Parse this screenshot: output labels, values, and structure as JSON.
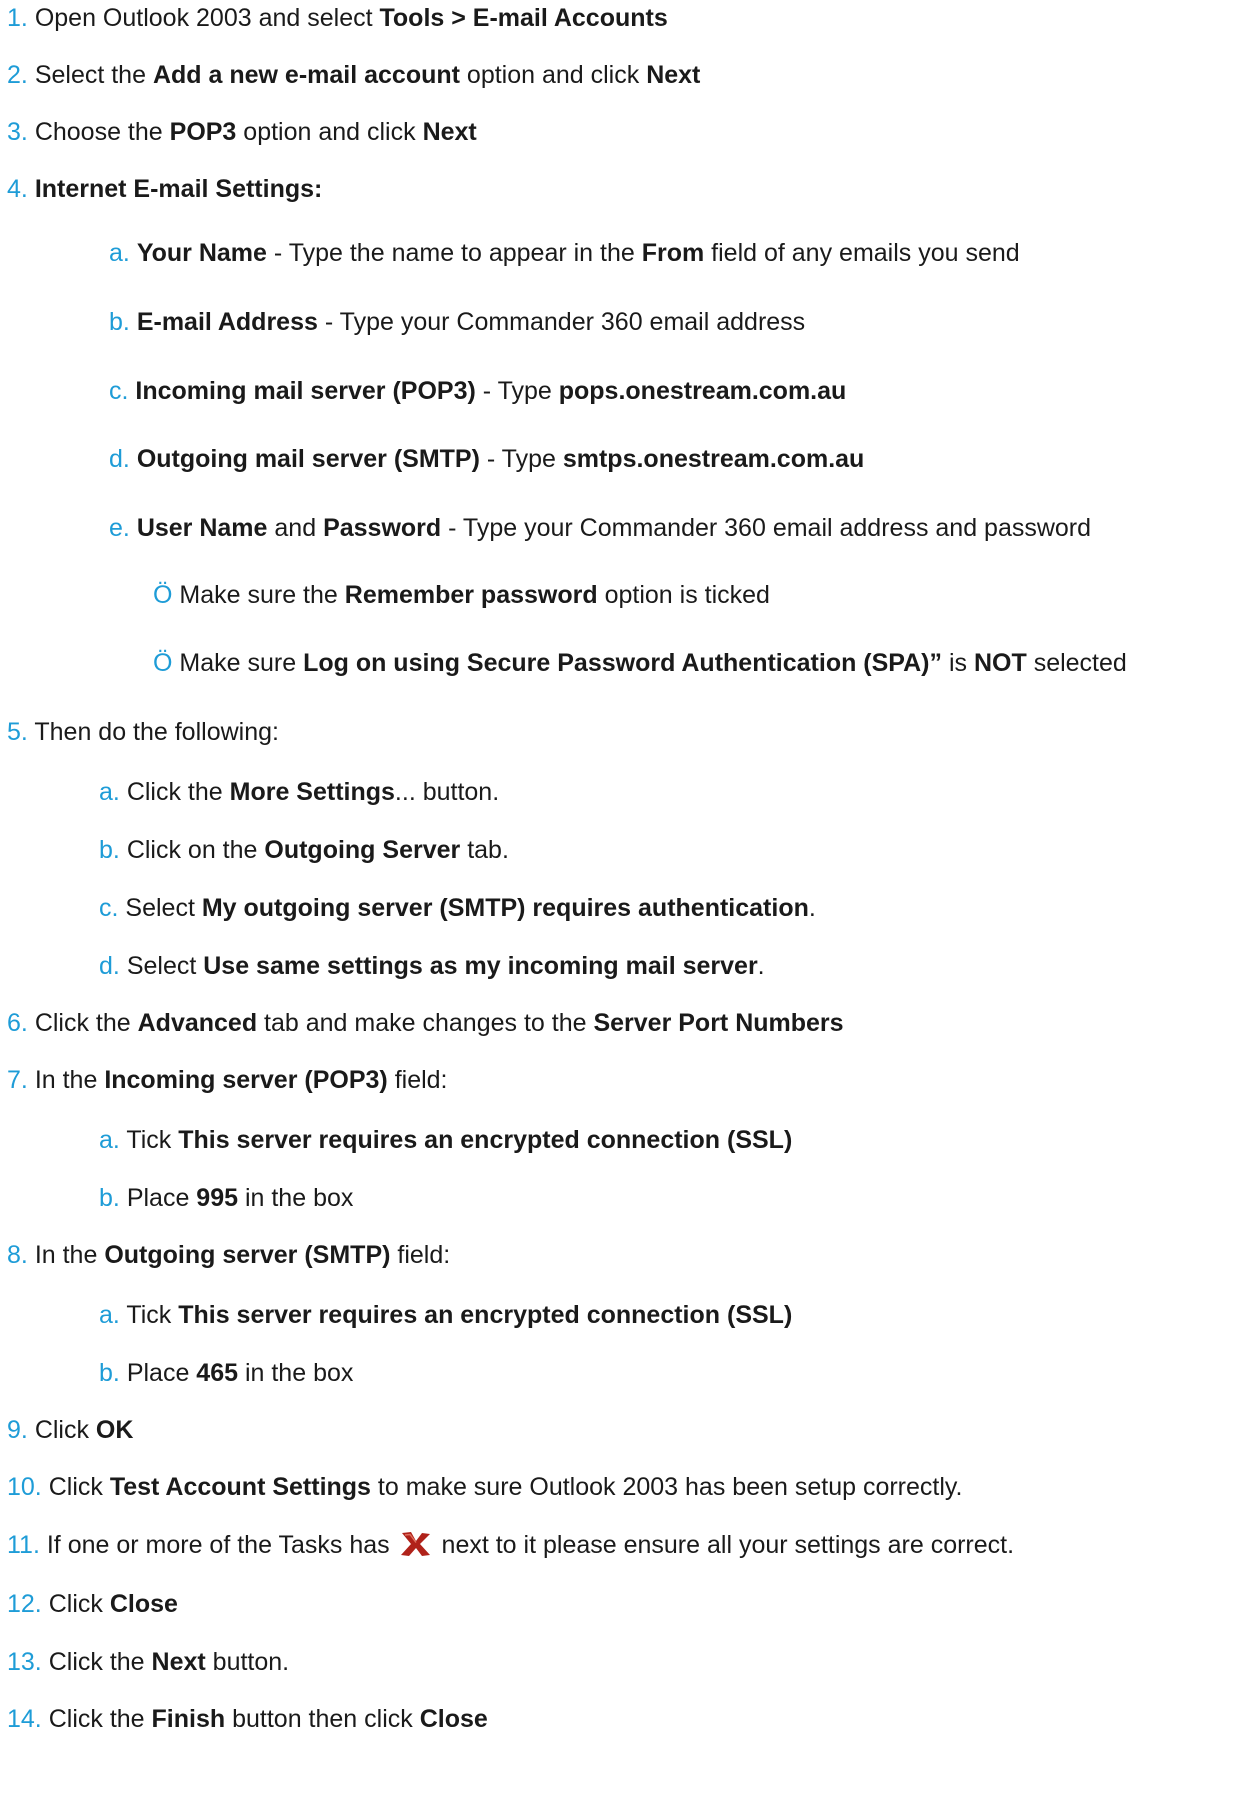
{
  "colors": {
    "number": "#1e9cd7",
    "text": "#1a1a1a",
    "x_icon": "#b0221a"
  },
  "steps": [
    {
      "num": "1.",
      "t1": "Open Outlook 2003 and select ",
      "b1": "Tools > E-mail Accounts"
    },
    {
      "num": "2.",
      "t1": "Select the ",
      "b1": "Add a new e-mail account",
      "t2": " option and click ",
      "b2": "Next"
    },
    {
      "num": "3.",
      "t1": "Choose the ",
      "b1": "POP3",
      "t2": " option and click ",
      "b2": "Next"
    },
    {
      "num": "4.",
      "b1": "Internet E-mail Settings:"
    },
    {
      "num": "5.",
      "t1": "Then do the following:"
    },
    {
      "num": "6.",
      "t1": "Click the ",
      "b1": "Advanced",
      "t2": " tab and make changes to the ",
      "b2": "Server Port Numbers"
    },
    {
      "num": "7.",
      "t1": "In the ",
      "b1": "Incoming server (POP3)",
      "t2": " field:"
    },
    {
      "num": "8.",
      "t1": "In the ",
      "b1": "Outgoing server (SMTP)",
      "t2": " field:"
    },
    {
      "num": "9.",
      "t1": "Click ",
      "b1": "OK"
    },
    {
      "num": "10.",
      "t1": "Click ",
      "b1": "Test Account Settings",
      "t2": " to make sure Outlook 2003 has been setup correctly."
    },
    {
      "num": "11.",
      "t1": "If one or more of the Tasks has ",
      "t2": " next to it please ensure all your settings are correct."
    },
    {
      "num": "12.",
      "t1": "Click ",
      "b1": "Close"
    },
    {
      "num": "13.",
      "t1": "Click the ",
      "b1": "Next",
      "t2": " button."
    },
    {
      "num": "14.",
      "t1": "Click the ",
      "b1": "Finish",
      "t2": " button then click ",
      "b2": "Close"
    }
  ],
  "step4_sub": [
    {
      "letter": "a.",
      "b1": "Your Name",
      "t1": " - Type the name to appear in the ",
      "b2": "From",
      "t2": " field of any emails you send"
    },
    {
      "letter": "b.",
      "b1": "E-mail Address",
      "t1": " - Type your Commander 360 email address"
    },
    {
      "letter": "c.",
      "b1": "Incoming mail server (POP3)",
      "t1": " - Type ",
      "b2": "pops.onestream.com.au"
    },
    {
      "letter": "d.",
      "b1": "Outgoing mail server (SMTP)",
      "t1": " - Type ",
      "b2": "smtps.onestream.com.au"
    },
    {
      "letter": "e.",
      "b1": "User Name",
      "t1": " and ",
      "b2": "Password",
      "t2": " - Type your Commander 360 email address and password"
    }
  ],
  "step4_checks": [
    {
      "mark": "Ö",
      "t1": " Make sure the ",
      "b1": "Remember password",
      "t2": " option is ticked"
    },
    {
      "mark": "Ö",
      "t1": " Make sure ",
      "b1": "Log on using Secure Password Authentication (SPA)”",
      "t2": " is ",
      "b2": "NOT",
      "t3": " selected"
    }
  ],
  "step5_sub": [
    {
      "letter": "a.",
      "t1": "Click the ",
      "b1": "More Settings",
      "t2": "... button."
    },
    {
      "letter": "b.",
      "t1": "Click on the ",
      "b1": "Outgoing Server",
      "t2": " tab."
    },
    {
      "letter": "c.",
      "t1": "Select ",
      "b1": "My outgoing server (SMTP) requires authentication",
      "t2": "."
    },
    {
      "letter": "d.",
      "t1": "Select ",
      "b1": "Use same settings as my incoming mail server",
      "t2": "."
    }
  ],
  "step7_sub": [
    {
      "letter": "a.",
      "t1": "Tick ",
      "b1": "This server requires an encrypted connection (SSL)"
    },
    {
      "letter": "b.",
      "t1": "Place ",
      "b1": "995",
      "t2": " in the box"
    }
  ],
  "step8_sub": [
    {
      "letter": "a.",
      "t1": "Tick ",
      "b1": "This server requires an encrypted connection (SSL)"
    },
    {
      "letter": "b.",
      "t1": "Place ",
      "b1": "465",
      "t2": " in the box"
    }
  ]
}
